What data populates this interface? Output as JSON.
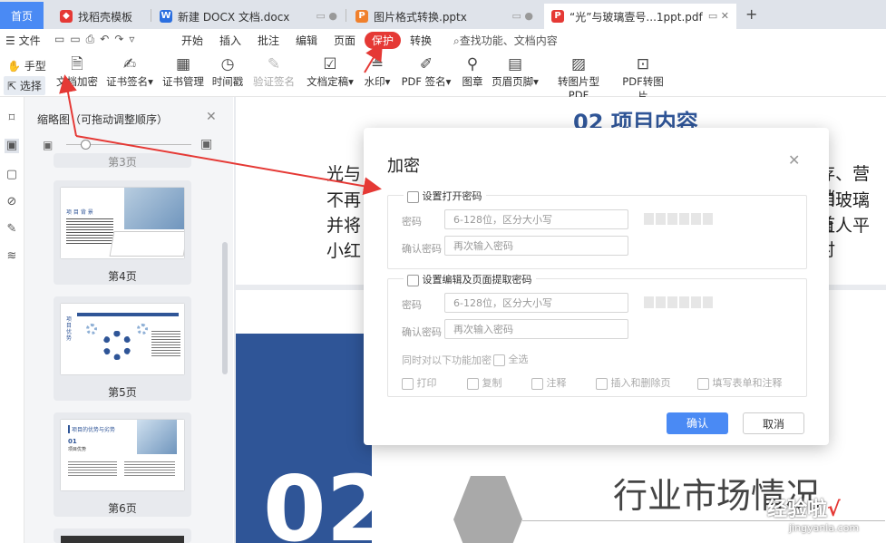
{
  "tabs": [
    {
      "label": "首页"
    },
    {
      "label": "找稻壳模板"
    },
    {
      "label": "新建 DOCX 文档.docx"
    },
    {
      "label": "图片格式转换.pptx"
    },
    {
      "label": "“光”与玻璃壹号...1ppt.pdf"
    }
  ],
  "menu": {
    "file": "文件",
    "items": [
      "开始",
      "插入",
      "批注",
      "编辑",
      "页面",
      "保护",
      "转换"
    ],
    "search_placeholder": "查找功能、文档内容"
  },
  "toolbar": {
    "hand": "手型",
    "select": "选择",
    "items": [
      "文档加密",
      "证书签名",
      "证书管理",
      "时间戳",
      "验证签名",
      "文档定稿",
      "水印",
      "PDF 签名",
      "图章",
      "页眉页脚",
      "转图片型PDF",
      "PDF转图片"
    ]
  },
  "thumbpane": {
    "title": "缩略图（可拖动调整顺序）",
    "partial_label": "第3页",
    "pages": [
      {
        "label": "第4页",
        "heading": "项 目 背 景"
      },
      {
        "label": "第5页",
        "heading": "项 目 优 势"
      },
      {
        "label": "第6页",
        "heading": "项目的优势与劣势",
        "num": "01",
        "sub": "项目优势"
      }
    ]
  },
  "document": {
    "page1_title": "02 项目内容",
    "lines_left": [
      "光与",
      "不再",
      "并将",
      "小红"
    ],
    "lines_right": [
      "存、营销",
      "和玻璃首",
      "让人平时"
    ],
    "page2_number": "02",
    "page2_heading": "行业市场情况"
  },
  "dialog": {
    "title": "加密",
    "open_pwd_label": "设置打开密码",
    "pwd_label": "密码",
    "pwd_placeholder": "6-128位，区分大小写",
    "confirm_label": "确认密码",
    "confirm_placeholder": "再次输入密码",
    "edit_pwd_label": "设置编辑及页面提取密码",
    "restrict_label": "同时对以下功能加密",
    "select_all": "全选",
    "options": [
      "打印",
      "复制",
      "注释",
      "插入和删除页",
      "填写表单和注释"
    ],
    "ok": "确认",
    "cancel": "取消"
  },
  "watermark": {
    "text": "经验啦",
    "check": "√",
    "url": "jingyanla.com"
  },
  "colors": {
    "accent": "#4a8af4",
    "protect": "#e53935",
    "annotation_arrow": "#e53935",
    "doc_blue": "#2f5597"
  }
}
